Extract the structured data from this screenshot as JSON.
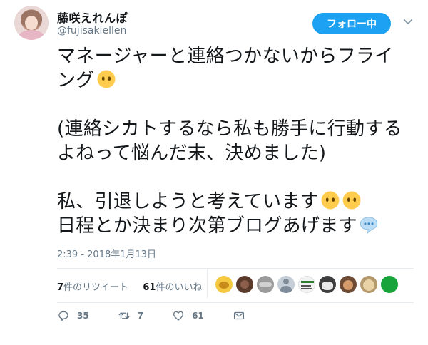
{
  "user": {
    "name": "藤咲えれんぽ",
    "handle": "@fujisakiellen"
  },
  "follow_button": {
    "label": "フォロー中"
  },
  "tweet": {
    "lines": [
      "マネージャーと連絡つかないからフライ",
      "ング",
      "",
      "(連絡シカトするなら私も勝手に行動する",
      "よねって悩んだ末、決めました)",
      "",
      "私、引退しようと考えています",
      "日程とか決まり次第ブログあげます"
    ],
    "timestamp": "2:39 - 2018年1月13日"
  },
  "stats": {
    "retweets_count": "7",
    "retweets_label": "件のリツイート",
    "likes_count": "61",
    "likes_label": "件のいいね"
  },
  "actions": {
    "replies": "35",
    "retweets": "7",
    "likes": "61"
  },
  "icons": {
    "caret": "chevron-down-icon",
    "emoji_blank": "face-without-mouth-emoji",
    "emoji_speech": "speech-balloon-emoji",
    "reply": "reply-icon",
    "retweet": "retweet-icon",
    "like": "heart-icon",
    "dm": "envelope-icon"
  },
  "colors": {
    "accent": "#1da1f2",
    "text": "#14171a",
    "muted": "#657786",
    "divider": "#e6ecf0"
  }
}
